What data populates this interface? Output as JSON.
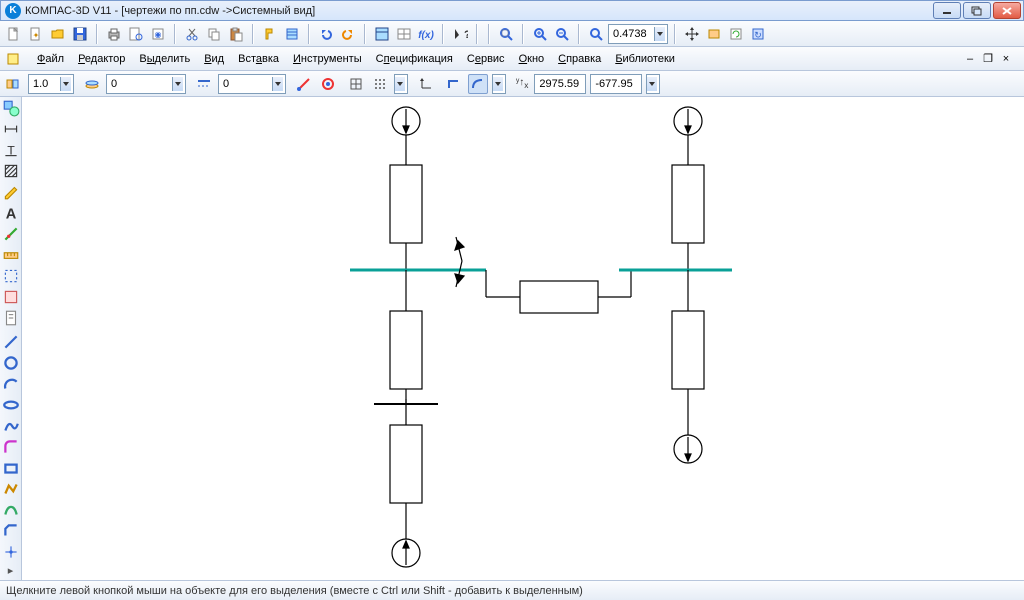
{
  "title": "КОМПАС-3D V11 - [чертежи по пп.cdw ->Системный вид]",
  "menus": {
    "file": "Файл",
    "edit": "Редактор",
    "select": "Выделить",
    "view": "Вид",
    "insert": "Вставка",
    "tools": "Инструменты",
    "spec": "Спецификация",
    "service": "Сервис",
    "window": "Окно",
    "help": "Справка",
    "libs": "Библиотеки"
  },
  "toolbar": {
    "zoom_value": "0.4738"
  },
  "params": {
    "scale": "1.0",
    "layer": "0",
    "style": "0",
    "coord_x": "2975.59",
    "coord_y": "-677.95"
  },
  "status": "Щелкните левой кнопкой мыши на объекте для его выделения (вместе с Ctrl или Shift - добавить к выделенным)"
}
